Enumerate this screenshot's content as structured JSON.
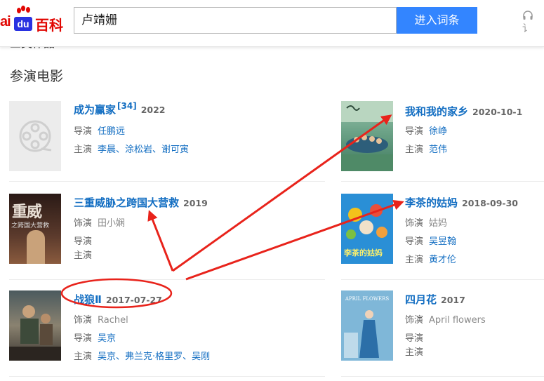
{
  "header": {
    "logo_bai": "ai",
    "logo_du": "du",
    "logo_baike": "百科",
    "search_value": "卢靖姗",
    "search_button": "进入词条",
    "listen_label": "讠"
  },
  "peek_text": "三类作品",
  "section_title": "参演电影",
  "films": [
    {
      "title": "成为赢家",
      "ref": "[34]",
      "date": "2022",
      "rows": [
        {
          "k": "导演",
          "v": "任鹏远"
        },
        {
          "k": "主演",
          "v": "李晨、涂松岩、谢可寅"
        }
      ]
    },
    {
      "title": "我和我的家乡",
      "ref": "",
      "date": "2020-10-1",
      "rows": [
        {
          "k": "导演",
          "v": "徐峥"
        },
        {
          "k": "主演",
          "v": "范伟"
        }
      ]
    },
    {
      "title": "三重威胁之跨国大营救",
      "ref": "",
      "date": "2019",
      "rows": [
        {
          "k": "饰演",
          "v": "田小娴"
        },
        {
          "k": "导演",
          "v": ""
        },
        {
          "k": "主演",
          "v": ""
        }
      ]
    },
    {
      "title": "李茶的姑妈",
      "ref": "",
      "date": "2018-09-30",
      "rows": [
        {
          "k": "饰演",
          "v": "姑妈"
        },
        {
          "k": "导演",
          "v": "吴昱翰"
        },
        {
          "k": "主演",
          "v": "黄才伦"
        }
      ]
    },
    {
      "title": "战狼Ⅱ",
      "ref": "",
      "date": "2017-07-27",
      "rows": [
        {
          "k": "饰演",
          "v": "Rachel"
        },
        {
          "k": "导演",
          "v": "吴京"
        },
        {
          "k": "主演",
          "v": "吴京、弗兰克·格里罗、吴刚"
        }
      ]
    },
    {
      "title": "四月花",
      "ref": "",
      "date": "2017",
      "rows": [
        {
          "k": "饰演",
          "v": "April flowers"
        },
        {
          "k": "导演",
          "v": ""
        },
        {
          "k": "主演",
          "v": ""
        }
      ]
    }
  ],
  "posters": {
    "three_threats_text": "重威",
    "three_threats_sub": "之跨国大营救",
    "lichag_text": "李茶的姑妈",
    "april_text": "APRIL FLOWERS"
  },
  "colors": {
    "link": "#136ec2",
    "accent": "#3385ff",
    "brand_red": "#e10602",
    "annotation": "#e8231b"
  }
}
